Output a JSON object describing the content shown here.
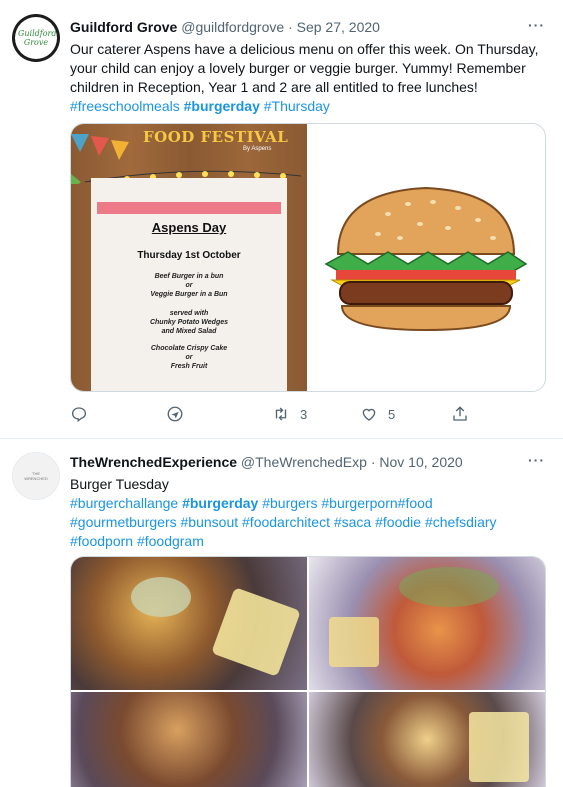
{
  "tweets": [
    {
      "name": "Guildford Grove",
      "handle": "@guildfordgrove",
      "sep": "·",
      "date": "Sep 27, 2020",
      "more": "···",
      "avatar_text": "Guildford Grove",
      "text": "Our caterer Aspens have a delicious menu on offer this week. On Thursday, your child can enjoy a lovely burger or veggie burger. Yummy! Remember children in Reception, Year 1 and 2 are all entitled to free lunches!",
      "hashtags": [
        "#freeschoolmeals",
        "#burgerday",
        "#Thursday"
      ],
      "poster": {
        "banner": "FOOD FESTIVAL",
        "by": "By Aspens",
        "heading": "Aspens Day",
        "date": "Thursday 1st October",
        "lines": [
          "Beef Burger in a bun",
          "or",
          "Veggie Burger in a Bun",
          "served with",
          "Chunky Potato Wedges",
          "and Mixed Salad",
          "Chocolate Crispy Cake",
          "or",
          "Fresh Fruit"
        ]
      },
      "actions": {
        "reply": "",
        "retweets": "3",
        "likes": "5"
      }
    },
    {
      "name": "TheWrenchedExperience",
      "handle": "@TheWrenchedExp",
      "sep": "·",
      "date": "Nov 10, 2020",
      "more": "···",
      "avatar_text": "THE WRENCHED",
      "text": "Burger Tuesday",
      "hashtags": [
        "#burgerchallange",
        "#burgerday",
        "#burgers",
        "#burgerporn",
        "#food",
        "#gourmetburgers",
        "#bunsout",
        "#foodarchitect",
        "#saca",
        "#foodie",
        "#chefsdiary",
        "#foodporn",
        "#foodgram"
      ]
    }
  ],
  "colors": {
    "link": "#1b95e0",
    "text": "#0f1419",
    "muted": "#536471",
    "border": "#cfd9de"
  }
}
